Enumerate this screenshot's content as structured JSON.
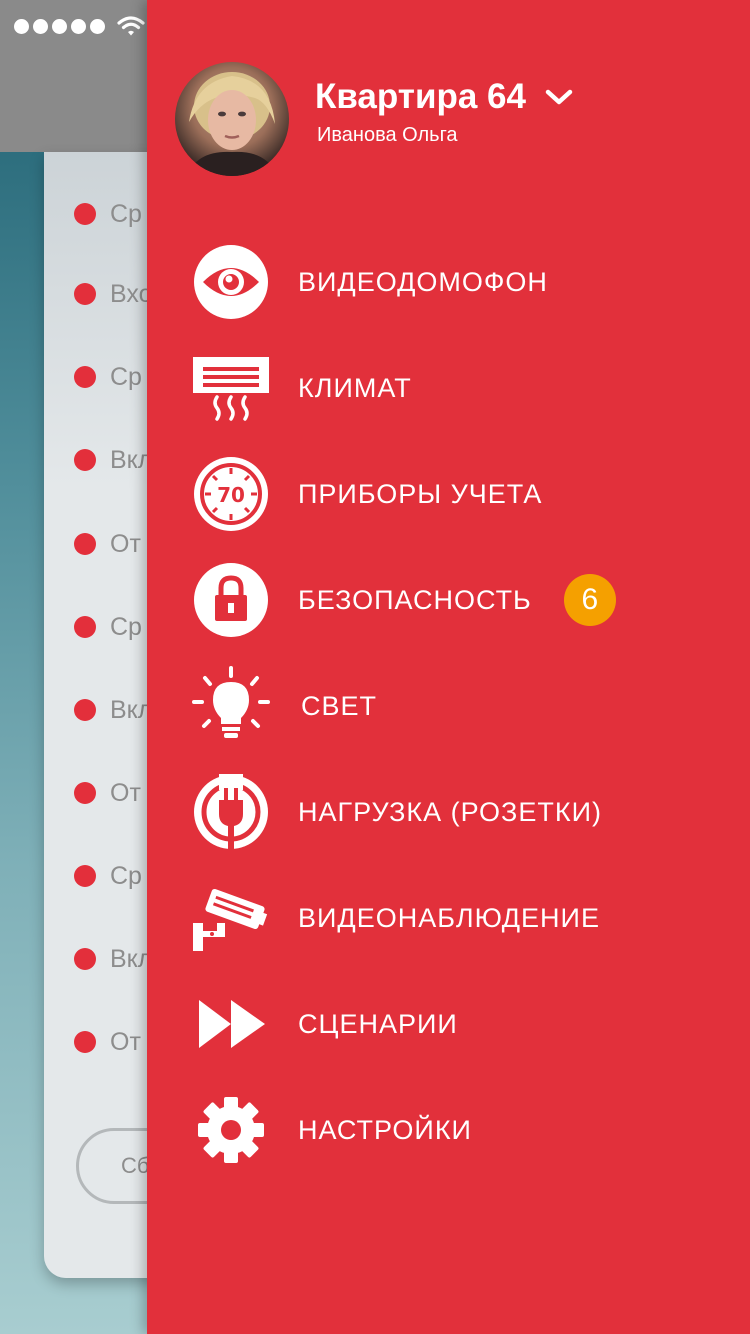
{
  "status_bar": {
    "signal_bars": 5,
    "icons": [
      "signal-dots-icon",
      "wifi-icon"
    ]
  },
  "background_list": {
    "events": [
      {
        "text": "Ср"
      },
      {
        "text": "Вхо"
      },
      {
        "text": "Ср"
      },
      {
        "text": "Вкл"
      },
      {
        "text": "От"
      },
      {
        "text": "Ср"
      },
      {
        "text": "Вкл"
      },
      {
        "text": "От"
      },
      {
        "text": "Ср"
      },
      {
        "text": "Вкл"
      },
      {
        "text": "От"
      }
    ],
    "reset_button_label": "Сб"
  },
  "drawer": {
    "profile": {
      "title": "Квартира 64",
      "subtitle": "Иванова Ольга",
      "avatar_icon": "user-avatar"
    },
    "menu": [
      {
        "label": "ВИДЕОДОМОФОН",
        "icon": "eye-icon"
      },
      {
        "label": "КЛИМАТ",
        "icon": "air-conditioner-icon"
      },
      {
        "label": "ПРИБОРЫ УЧЕТА",
        "icon": "meter-gauge-icon"
      },
      {
        "label": "БЕЗОПАСНОСТЬ",
        "icon": "lock-icon",
        "badge": "6"
      },
      {
        "label": "СВЕТ",
        "icon": "light-bulb-icon"
      },
      {
        "label": "НАГРУЗКА (РОЗЕТКИ)",
        "icon": "plug-icon"
      },
      {
        "label": "ВИДЕОНАБЛЮДЕНИЕ",
        "icon": "security-camera-icon"
      },
      {
        "label": "СЦЕНАРИИ",
        "icon": "fast-forward-icon"
      },
      {
        "label": "НАСТРОЙКИ",
        "icon": "gear-icon"
      }
    ]
  },
  "colors": {
    "drawer_bg": "#e2303b",
    "badge_bg": "#f5a000",
    "event_dot": "#e32f3b",
    "topbar_bg": "#8a8a8a"
  }
}
